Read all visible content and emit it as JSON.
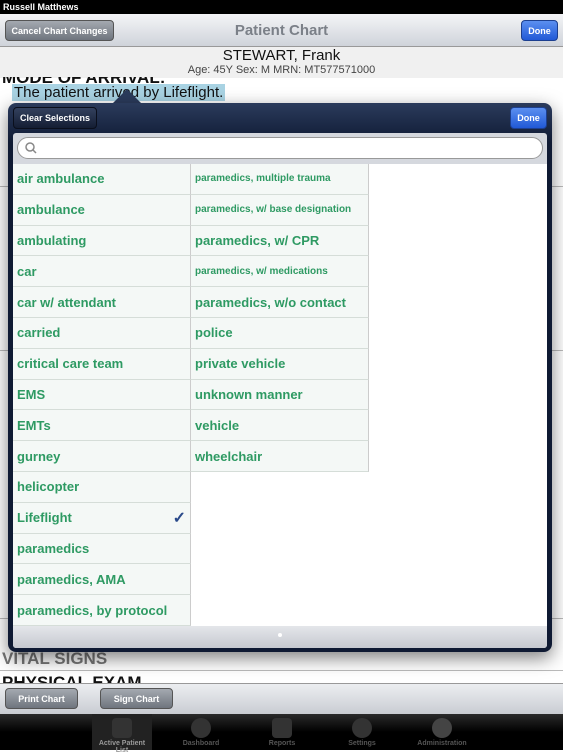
{
  "status_bar": {
    "user": "Russell Matthews"
  },
  "nav": {
    "cancel_label": "Cancel Chart Changes",
    "title": "Patient Chart",
    "done_label": "Done"
  },
  "patient": {
    "name": "STEWART, Frank",
    "info": "Age: 45Y Sex: M MRN: MT577571000"
  },
  "chart": {
    "mode_heading": "MODE OF ARRIVAL:",
    "mode_text": "The patient arrived by Lifeflight.",
    "vital_signs": "VITAL SIGNS",
    "physical_exam": "PHYSICAL EXAM"
  },
  "popover": {
    "clear_label": "Clear Selections",
    "done_label": "Done",
    "search_placeholder": "",
    "column1": [
      {
        "label": "air ambulance"
      },
      {
        "label": "ambulance"
      },
      {
        "label": "ambulating"
      },
      {
        "label": "car"
      },
      {
        "label": "car w/ attendant"
      },
      {
        "label": "carried"
      },
      {
        "label": "critical care team"
      },
      {
        "label": "EMS"
      },
      {
        "label": "EMTs"
      },
      {
        "label": "gurney"
      },
      {
        "label": "helicopter"
      },
      {
        "label": "Lifeflight",
        "checked": true
      },
      {
        "label": "paramedics"
      },
      {
        "label": "paramedics, AMA"
      },
      {
        "label": "paramedics, by protocol"
      }
    ],
    "column2": [
      {
        "label": "paramedics, multiple trauma",
        "small": true
      },
      {
        "label": "paramedics, w/ base designation",
        "small": true
      },
      {
        "label": "paramedics, w/ CPR"
      },
      {
        "label": "paramedics, w/ medications",
        "small": true
      },
      {
        "label": "paramedics, w/o contact"
      },
      {
        "label": "police"
      },
      {
        "label": "private vehicle"
      },
      {
        "label": "unknown manner"
      },
      {
        "label": "vehicle"
      },
      {
        "label": "wheelchair"
      }
    ]
  },
  "toolbar": {
    "print_label": "Print Chart",
    "sign_label": "Sign Chart"
  },
  "tabs": [
    {
      "label": "Active Patient List",
      "active": true
    },
    {
      "label": "Dashboard"
    },
    {
      "label": "Reports"
    },
    {
      "label": "Settings"
    },
    {
      "label": "Administration"
    }
  ]
}
